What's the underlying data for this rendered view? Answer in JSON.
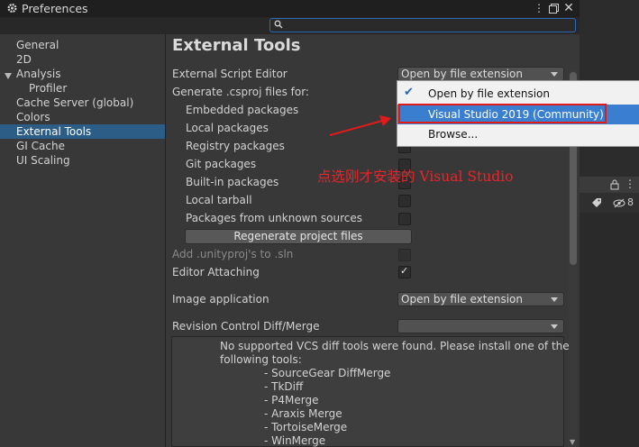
{
  "window": {
    "title": "Preferences",
    "menu_icon": "kebab-menu-icon",
    "restore_icon": "restore-window-icon",
    "close_icon": "close-icon"
  },
  "search": {
    "placeholder": "",
    "value": "",
    "icon": "search-icon"
  },
  "side_panel": {
    "eye_count": "8",
    "lock_icon": "lock-icon",
    "tag_icon": "tag-icon",
    "eye_icon": "hidden-eye-icon"
  },
  "nav": {
    "items": [
      {
        "label": "General"
      },
      {
        "label": "2D"
      },
      {
        "label": "Analysis"
      },
      {
        "label": "Profiler"
      },
      {
        "label": "Cache Server (global)"
      },
      {
        "label": "Colors"
      },
      {
        "label": "External Tools",
        "selected": true
      },
      {
        "label": "GI Cache"
      },
      {
        "label": "UI Scaling"
      }
    ]
  },
  "main": {
    "title": "External Tools",
    "script_editor_label": "External Script Editor",
    "script_editor_value": "Open by file extension",
    "generate_label": "Generate .csproj files for:",
    "packages": [
      {
        "label": "Embedded packages",
        "checked": false
      },
      {
        "label": "Local packages",
        "checked": false
      },
      {
        "label": "Registry packages",
        "checked": false
      },
      {
        "label": "Git packages",
        "checked": false
      },
      {
        "label": "Built-in packages",
        "checked": false
      },
      {
        "label": "Local tarball",
        "checked": false
      },
      {
        "label": "Packages from unknown sources",
        "checked": false
      }
    ],
    "regenerate_label": "Regenerate project files",
    "add_unityproj_label": "Add .unityproj's to .sln",
    "editor_attaching_label": "Editor Attaching",
    "editor_attaching_checked": true,
    "image_app_label": "Image application",
    "image_app_value": "Open by file extension",
    "revision_label": "Revision Control Diff/Merge",
    "revision_value": "",
    "vcs_message_1": "No supported VCS diff tools were found. Please install one of the",
    "vcs_message_2": "following tools:",
    "vcs_tools": [
      "- SourceGear DiffMerge",
      "- TkDiff",
      "- P4Merge",
      "- Araxis Merge",
      "- TortoiseMerge",
      "- WinMerge"
    ]
  },
  "popup": {
    "items": [
      {
        "label": "Open by file extension",
        "checked": true
      },
      {
        "label": "Visual Studio 2019 (Community)",
        "highlighted": true
      },
      {
        "label": "Browse..."
      }
    ]
  },
  "annotation": {
    "text": "点选刚才安装的 Visual Studio",
    "color": "#e8252b"
  },
  "colors": {
    "selection": "#2c5d87",
    "popup_highlight": "#3a7fcf",
    "annotation_red": "#e21a1a"
  }
}
